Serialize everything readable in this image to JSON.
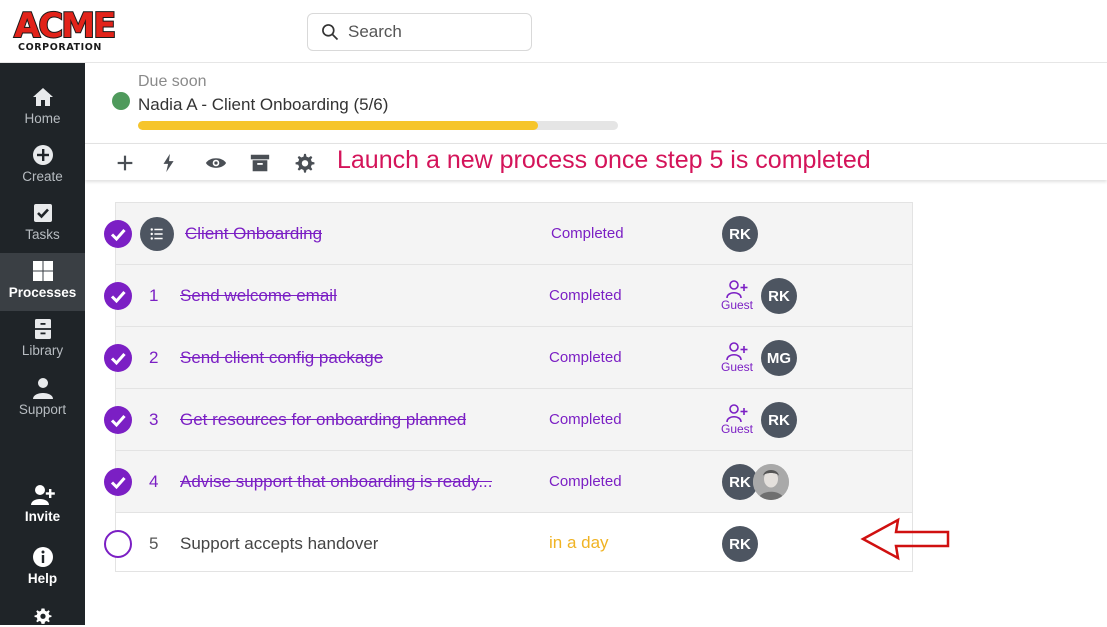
{
  "brand": {
    "word": "ACME",
    "sub": "CORPORATION",
    "color": "#e2231a"
  },
  "search": {
    "placeholder": "Search"
  },
  "sidebar": {
    "items": [
      {
        "label": "Home",
        "icon": "home-icon"
      },
      {
        "label": "Create",
        "icon": "plus-circle-icon"
      },
      {
        "label": "Tasks",
        "icon": "checkbox-icon"
      },
      {
        "label": "Processes",
        "icon": "grid-icon",
        "active": true
      },
      {
        "label": "Library",
        "icon": "cabinet-icon"
      },
      {
        "label": "Support",
        "icon": "person-icon"
      }
    ],
    "bottom": [
      {
        "label": "Invite",
        "icon": "add-user-icon"
      },
      {
        "label": "Help",
        "icon": "info-icon"
      },
      {
        "label": "",
        "icon": "gear-icon"
      }
    ]
  },
  "run": {
    "due_label": "Due soon",
    "title": "Nadia A - Client Onboarding (5/6)",
    "progress_fraction": 0.833,
    "status_color": "#4f9a5c",
    "progress_color": "#f6c52b"
  },
  "toolbar": {
    "icons": [
      "plus-icon",
      "lightning-icon",
      "eye-icon",
      "archive-icon",
      "gear-icon"
    ],
    "annotation": "Launch a new process once step 5 is completed"
  },
  "tasks": [
    {
      "number": "",
      "title": "Client Onboarding",
      "status": "Completed",
      "guest": false,
      "assignees": [
        "RK"
      ],
      "completed": true,
      "is_header": true
    },
    {
      "number": "1",
      "title": "Send welcome email",
      "status": "Completed",
      "guest": true,
      "guest_label": "Guest",
      "assignees": [
        "RK"
      ],
      "completed": true
    },
    {
      "number": "2",
      "title": "Send client config package",
      "status": "Completed",
      "guest": true,
      "guest_label": "Guest",
      "assignees": [
        "MG"
      ],
      "completed": true
    },
    {
      "number": "3",
      "title": "Get resources for onboarding planned",
      "status": "Completed",
      "guest": true,
      "guest_label": "Guest",
      "assignees": [
        "RK"
      ],
      "completed": true
    },
    {
      "number": "4",
      "title": "Advise support that onboarding is ready...",
      "status": "Completed",
      "guest": false,
      "assignees": [
        "RK",
        "photo"
      ],
      "completed": true
    },
    {
      "number": "5",
      "title": "Support accepts handover",
      "status": "in a day",
      "guest": false,
      "assignees": [
        "RK"
      ],
      "completed": false
    }
  ],
  "colors": {
    "accent": "#7b1fc4",
    "due": "#f0b323",
    "annotation": "#d4145a",
    "arrow": "#d01010"
  }
}
